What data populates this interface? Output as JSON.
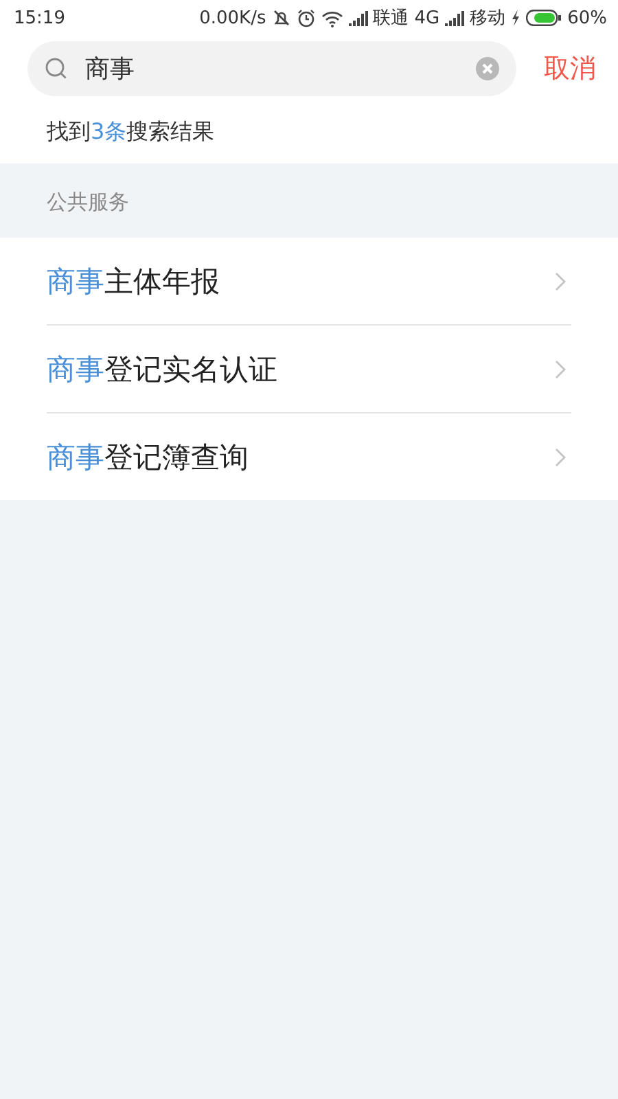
{
  "status_bar": {
    "time": "15:19",
    "speed": "0.00K/s",
    "carrier_1": "联通",
    "network_1": "4G",
    "carrier_2": "移动",
    "battery": "60%"
  },
  "search": {
    "value": "商事",
    "cancel": "取消"
  },
  "result_summary": {
    "prefix": "找到",
    "count": "3条",
    "suffix": "搜索结果"
  },
  "section": {
    "title": "公共服务",
    "items": [
      {
        "highlight": "商事",
        "rest": "主体年报"
      },
      {
        "highlight": "商事",
        "rest": "登记实名认证"
      },
      {
        "highlight": "商事",
        "rest": "登记簿查询"
      }
    ]
  }
}
